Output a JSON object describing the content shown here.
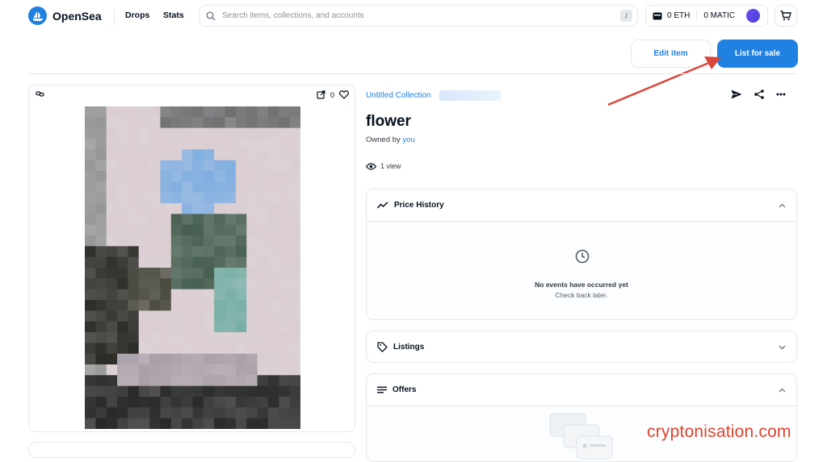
{
  "header": {
    "brand": "OpenSea",
    "nav": [
      "Drops",
      "Stats"
    ],
    "search_placeholder": "Search items, collections, and accounts",
    "search_shortcut": "/",
    "wallet": {
      "eth": "0 ETH",
      "matic": "0 MATIC"
    }
  },
  "toolbar": {
    "edit_label": "Edit item",
    "list_label": "List for sale"
  },
  "media": {
    "likes": "0"
  },
  "item": {
    "collection": "Untitled Collection",
    "title": "flower",
    "owned_prefix": "Owned by",
    "owner": "you",
    "views": "1 view"
  },
  "panels": {
    "price_history": {
      "title": "Price History",
      "empty_title": "No events have occurred yet",
      "empty_sub": "Check back later."
    },
    "listings": {
      "title": "Listings"
    },
    "offers": {
      "title": "Offers"
    }
  },
  "watermark": "cryptonisation.com",
  "colors": {
    "accent": "#2081e2",
    "annotation_arrow": "#d9473a",
    "watermark": "#e0442e"
  }
}
